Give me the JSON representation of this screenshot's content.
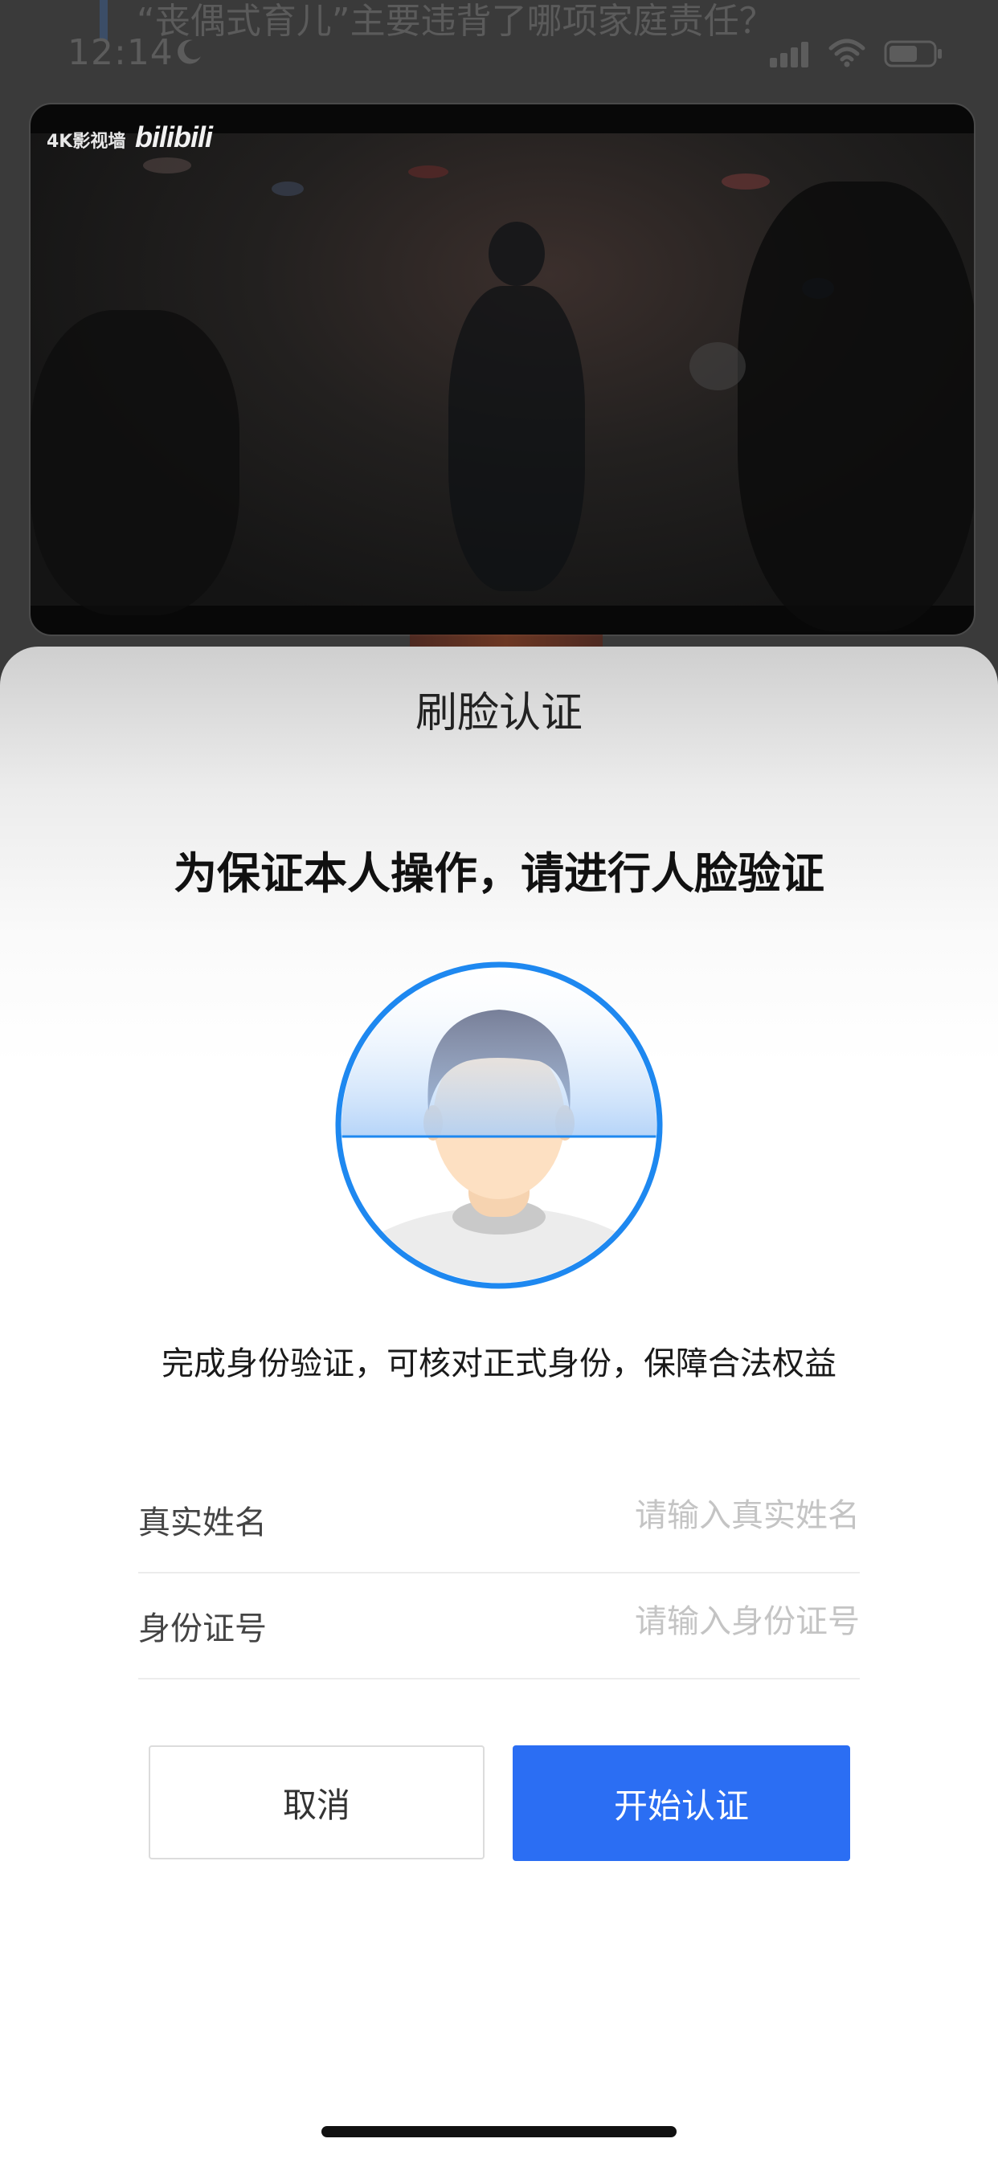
{
  "background": {
    "headline": "“丧偶式育儿”主要违背了哪项家庭责任？",
    "video_logo_text": "4K影视墙",
    "video_brand": "bilibili"
  },
  "status_bar": {
    "time": "12:14",
    "icons": [
      "moon-icon",
      "signal-icon",
      "wifi-icon",
      "battery-icon"
    ]
  },
  "sheet": {
    "title": "刷脸认证",
    "heading": "为保证本人操作，请进行人脸验证",
    "description": "完成身份验证，可核对正式身份，保障合法权益",
    "form": {
      "name": {
        "label": "真实姓名",
        "placeholder": "请输入真实姓名",
        "value": ""
      },
      "id": {
        "label": "身份证号",
        "placeholder": "请输入身份证号",
        "value": ""
      }
    },
    "cancel_label": "取消",
    "start_label": "开始认证"
  },
  "colors": {
    "accent": "#2b6ef3",
    "face_ring": "#1e88f0"
  }
}
